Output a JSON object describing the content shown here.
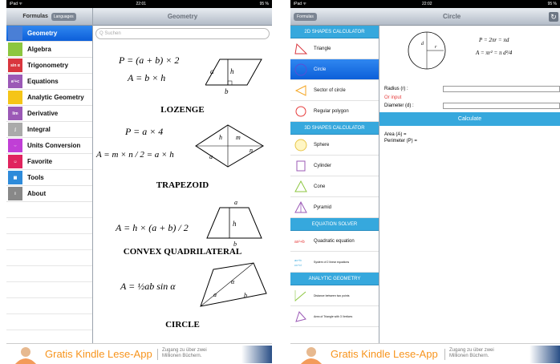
{
  "left": {
    "status": {
      "carrier": "iPad ᯤ",
      "time": "22:01",
      "battery": "95 %"
    },
    "nav": {
      "tab_active": "Formulas",
      "tab_other": "Languages",
      "title": "Geometry"
    },
    "search_placeholder": "Q Suchen",
    "menu": [
      {
        "label": "Geometry",
        "icon": "geometry-icon",
        "color": "#4a7fd6",
        "selected": true
      },
      {
        "label": "Algebra",
        "icon": "algebra-icon",
        "color": "#8cc63f"
      },
      {
        "label": "Trigonometry",
        "icon": "trigonometry-icon",
        "color": "#d9363e",
        "glyph": "sin α"
      },
      {
        "label": "Equations",
        "icon": "equations-icon",
        "color": "#9b59b6",
        "glyph": "a²+c"
      },
      {
        "label": "Analytic Geometry",
        "icon": "analytic-geometry-icon",
        "color": "#f5c518"
      },
      {
        "label": "Derivative",
        "icon": "derivative-icon",
        "color": "#9b59b6",
        "glyph": "lim"
      },
      {
        "label": "Integral",
        "icon": "integral-icon",
        "color": "#aaaaaa",
        "glyph": "∫"
      },
      {
        "label": "Units Conversion",
        "icon": "units-conversion-icon",
        "color": "#c03fd6",
        "glyph": "⇔"
      },
      {
        "label": "Favorite",
        "icon": "favorite-icon",
        "color": "#e0245e",
        "glyph": "☺"
      },
      {
        "label": "Tools",
        "icon": "tools-icon",
        "color": "#2e8bda",
        "glyph": "▦"
      },
      {
        "label": "About",
        "icon": "about-icon",
        "color": "#888888",
        "glyph": "i"
      }
    ],
    "sections": {
      "f1": "P = (a + b) × 2",
      "f2": "A = b × h",
      "lozenge": "LOZENGE",
      "f3": "P = a × 4",
      "f4": "A = m × n / 2 = a × h",
      "trapezoid": "TRAPEZOID",
      "f5": "A = h × (a + b) / 2",
      "convex": "CONVEX QUADRILATERAL",
      "f6": "A = ½ab sin α",
      "circle": "CIRCLE"
    },
    "ad": {
      "text": "Gratis Kindle Lese-App",
      "sub1": "Zugang zu über zwei",
      "sub2": "Millionen Büchern."
    }
  },
  "right": {
    "status": {
      "carrier": "iPad ᯤ",
      "time": "22:02",
      "battery": "95 %"
    },
    "nav": {
      "back": "Formulas",
      "title": "Circle"
    },
    "calc_list": [
      {
        "type": "header",
        "label": "2D SHAPES CALCULATOR"
      },
      {
        "label": "Triangle",
        "icon": "triangle-icon"
      },
      {
        "label": "Circle",
        "icon": "circle-icon",
        "selected": true
      },
      {
        "label": "Sector of circle",
        "icon": "sector-icon"
      },
      {
        "label": "Regular polygon",
        "icon": "polygon-icon"
      },
      {
        "type": "header",
        "label": "3D SHAPES CALCULATOR"
      },
      {
        "label": "Sphere",
        "icon": "sphere-icon"
      },
      {
        "label": "Cylinder",
        "icon": "cylinder-icon"
      },
      {
        "label": "Cone",
        "icon": "cone-icon"
      },
      {
        "label": "Pyramid",
        "icon": "pyramid-icon"
      },
      {
        "type": "header",
        "label": "EQUATION SOLVER"
      },
      {
        "label": "Quadratic equation",
        "icon": "quadratic-icon"
      },
      {
        "label": "System of 2 linear equations",
        "icon": "linear-system-icon",
        "small": true
      },
      {
        "type": "header",
        "label": "ANALYTIC GEOMETRY"
      },
      {
        "label": "Distance between two points",
        "icon": "distance-icon",
        "small": true
      },
      {
        "label": "Area of Triangle with 3 Vertices",
        "icon": "area-triangle-icon",
        "small": true
      }
    ],
    "formulas": {
      "p": "P = 2πr = πd",
      "a": "A = πr² = π d²/4"
    },
    "form": {
      "radius_label": "Radius (r) :",
      "or_input": "Or input",
      "diameter_label": "Diameter (d) :",
      "calculate": "Calculate",
      "area": "Area (A) =",
      "perimeter": "Perimeter (P) ="
    },
    "ad": {
      "text": "Gratis Kindle Lese-App",
      "sub1": "Zugang zu über zwei",
      "sub2": "Millionen Büchern."
    }
  }
}
